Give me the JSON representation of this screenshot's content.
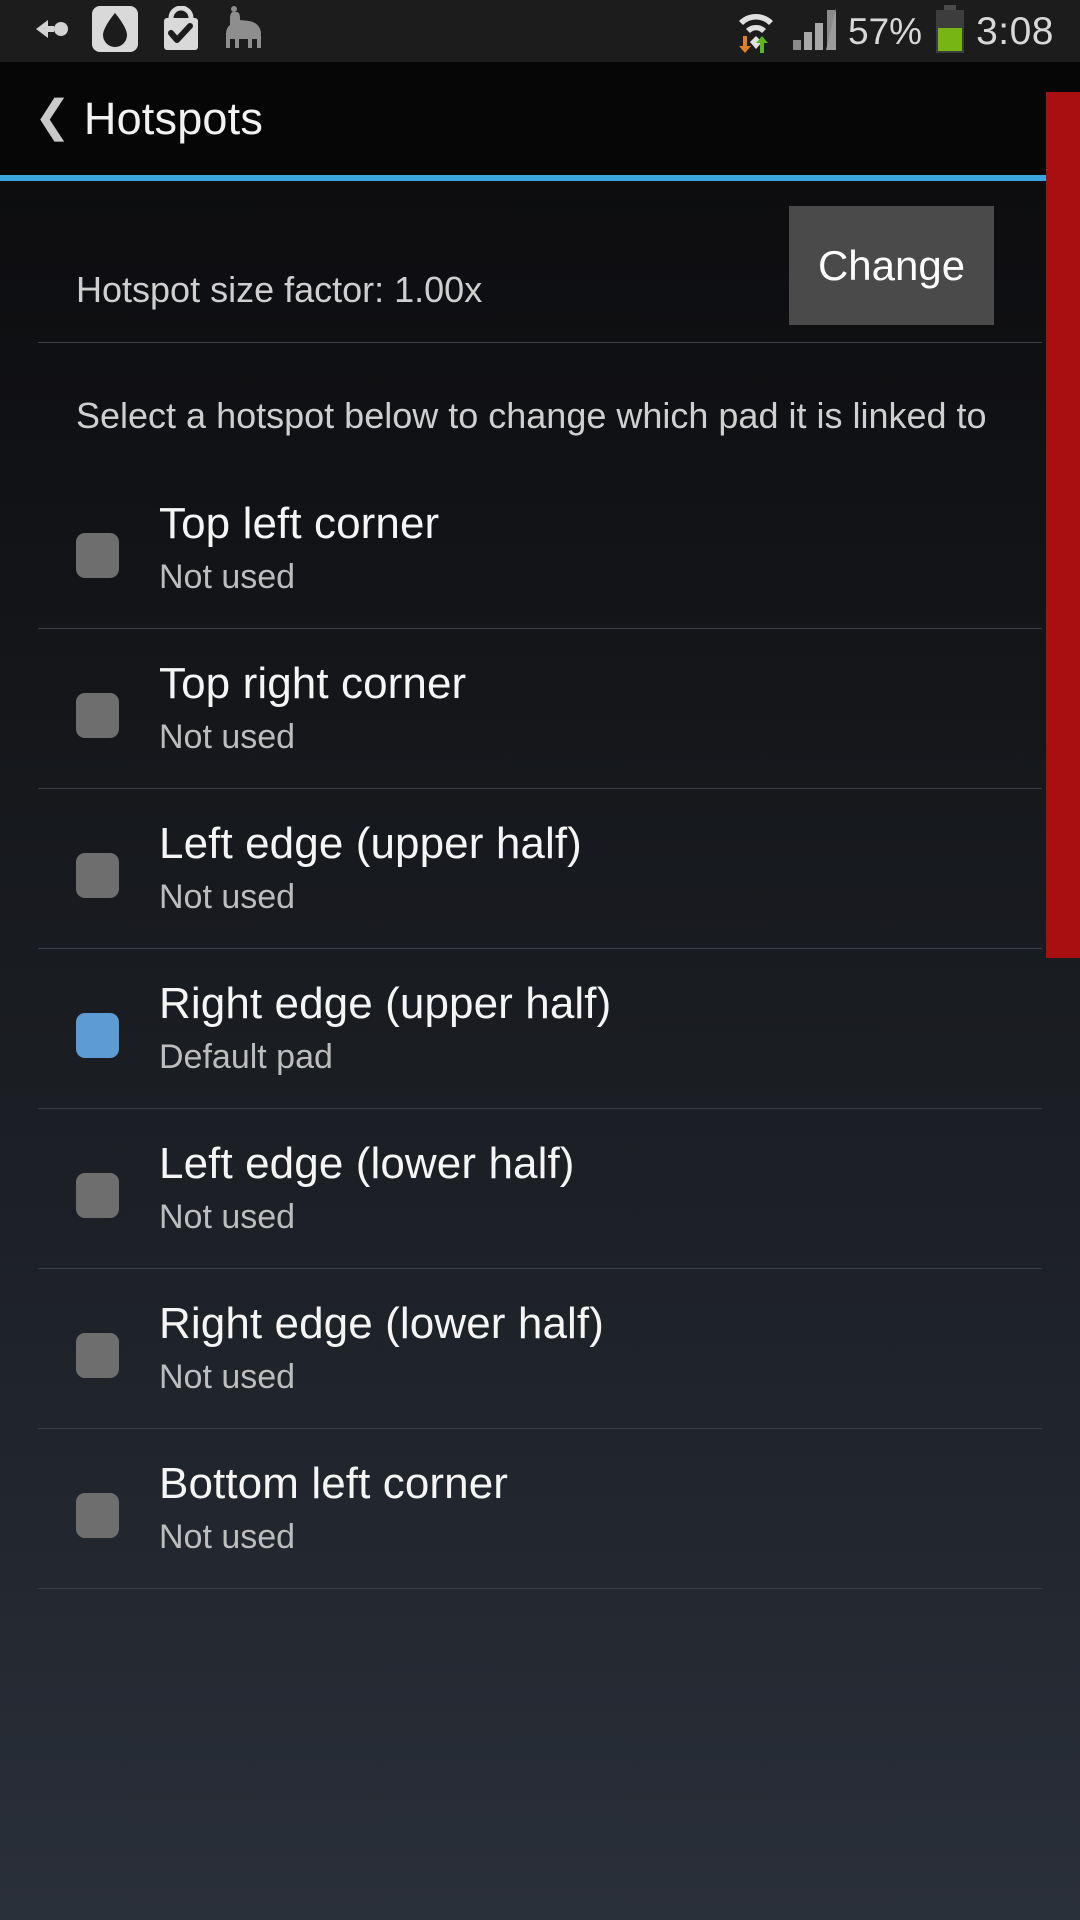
{
  "status_bar": {
    "left_icons": [
      {
        "name": "back-arrow-dot-icon",
        "glyph": "arrow-dot"
      },
      {
        "name": "droplet-app-icon",
        "glyph": "droplet"
      },
      {
        "name": "shopping-bag-check-icon",
        "glyph": "bag-check"
      },
      {
        "name": "llama-icon",
        "glyph": "llama"
      }
    ],
    "wifi_icon": "wifi-transfer-icon",
    "signal_icon": "cellular-signal-icon",
    "battery_percent": "57%",
    "battery_icon": "battery-icon",
    "clock": "3:08"
  },
  "title_bar": {
    "back_icon": "back-chevron-icon",
    "title": "Hotspots",
    "accent_color": "#3ba3dd"
  },
  "edge_bar": {
    "name": "red-edge-indicator",
    "color": "#a90e10"
  },
  "settings": {
    "size_factor_label": "Hotspot size factor: 1.00x",
    "change_button_label": "Change",
    "instruction": "Select a hotspot below to change which pad it is linked to"
  },
  "hotspots": [
    {
      "title": "Top left corner",
      "status": "Not used",
      "selected": false,
      "color": "#6e6e6e"
    },
    {
      "title": "Top right corner",
      "status": "Not used",
      "selected": false,
      "color": "#6e6e6e"
    },
    {
      "title": "Left edge (upper half)",
      "status": "Not used",
      "selected": false,
      "color": "#6e6e6e"
    },
    {
      "title": "Right edge (upper half)",
      "status": "Default pad",
      "selected": true,
      "color": "#5d9bd5"
    },
    {
      "title": "Left edge (lower half)",
      "status": "Not used",
      "selected": false,
      "color": "#6e6e6e"
    },
    {
      "title": "Right edge (lower half)",
      "status": "Not used",
      "selected": false,
      "color": "#6e6e6e"
    },
    {
      "title": "Bottom left corner",
      "status": "Not used",
      "selected": false,
      "color": "#6e6e6e"
    }
  ]
}
